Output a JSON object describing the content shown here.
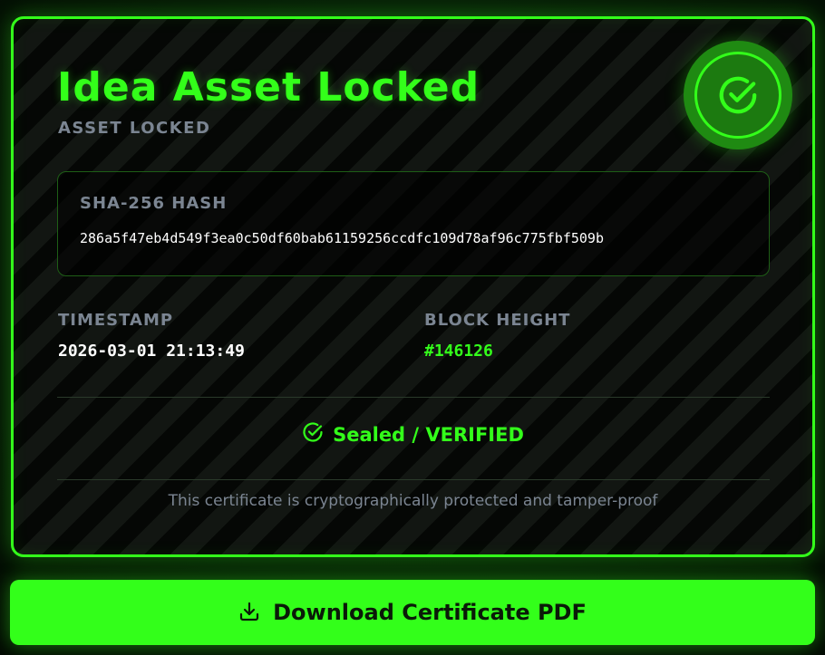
{
  "certificate": {
    "title": "Idea Asset Locked",
    "subtitle": "ASSET LOCKED",
    "badge_icon": "check-circle-icon",
    "hash": {
      "label": "SHA-256 HASH",
      "value": "286a5f47eb4d549f3ea0c50df60bab61159256ccdfc109d78af96c775fbf509b"
    },
    "timestamp": {
      "label": "TIMESTAMP",
      "value": "2026-03-01 21:13:49"
    },
    "block_height": {
      "label": "BLOCK HEIGHT",
      "value": "#146126"
    },
    "status": {
      "icon": "check-circle-icon",
      "text": "Sealed / VERIFIED"
    },
    "footnote": "This certificate is cryptographically protected and tamper-proof"
  },
  "actions": {
    "download_icon": "download-icon",
    "download_label": "Download Certificate PDF"
  },
  "colors": {
    "accent": "#33ff1a",
    "muted_text": "#7b8592",
    "card_background": "#050705",
    "button_text": "#0a1a08"
  }
}
